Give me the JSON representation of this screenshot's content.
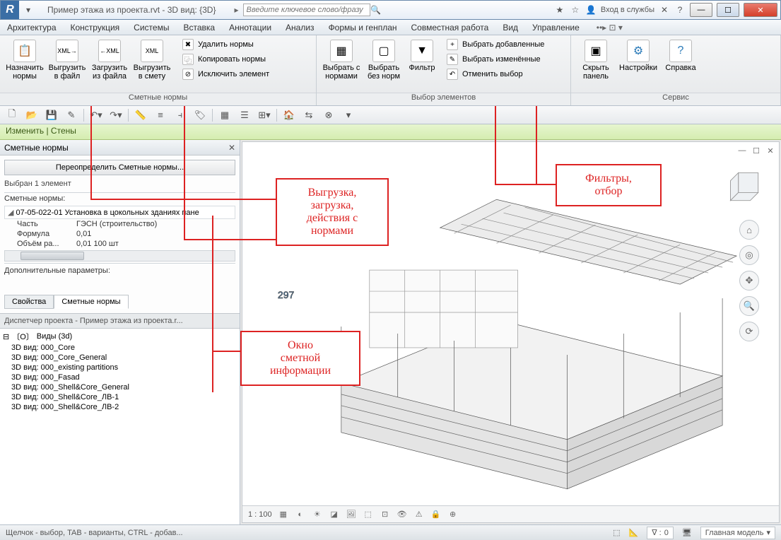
{
  "titlebar": {
    "title": "Пример этажа из проекта.rvt - 3D вид: {3D}",
    "search_placeholder": "Введите ключевое слово/фразу",
    "login_label": "Вход в службы"
  },
  "menu": {
    "items": [
      "Архитектура",
      "Конструкция",
      "Системы",
      "Вставка",
      "Аннотации",
      "Анализ",
      "Формы и генплан",
      "Совместная работа",
      "Вид",
      "Управление"
    ]
  },
  "ribbon": {
    "group1": {
      "title": "Сметные нормы",
      "btn_assign": "Назначить нормы",
      "btn_export": "Выгрузить в файл",
      "btn_import": "Загрузить из файла",
      "btn_export_est": "Выгрузить в смету",
      "btn_delete": "Удалить нормы",
      "btn_copy": "Копировать нормы",
      "btn_exclude": "Исключить элемент"
    },
    "group2": {
      "title": "Выбор элементов",
      "btn_sel_with": "Выбрать с нормами",
      "btn_sel_without": "Выбрать без норм",
      "btn_filter": "Фильтр",
      "btn_sel_added": "Выбрать добавленные",
      "btn_sel_changed": "Выбрать изменённые",
      "btn_cancel_sel": "Отменить выбор"
    },
    "group3": {
      "title": "Сервис",
      "btn_hide": "Скрыть панель",
      "btn_settings": "Настройки",
      "btn_help": "Справка"
    }
  },
  "context_bar": "Изменить | Стены",
  "panel": {
    "title": "Сметные нормы",
    "override_btn": "Переопределить Сметные нормы...",
    "selection_text": "Выбран 1 элемент",
    "norms_label": "Сметные нормы:",
    "norm_code": "07-05-022-01 Установка в цокольных зданиях пане",
    "row_part_l": "Часть",
    "row_part_r": "ГЭСН (строительство)",
    "row_formula_l": "Формула",
    "row_formula_r": "0,01",
    "row_volume_l": "Объём ра...",
    "row_volume_r": "0,01 100 шт",
    "addl_label": "Дополнительные параметры:",
    "tab_props": "Свойства",
    "tab_norms": "Сметные нормы"
  },
  "browser": {
    "title": "Диспетчер проекта - Пример этажа из проекта.r...",
    "root": "Виды (3d)",
    "items": [
      "3D вид: 000_Core",
      "3D вид: 000_Core_General",
      "3D вид: 000_existing partitions",
      "3D вид: 000_Fasad",
      "3D вид: 000_Shell&Core_General",
      "3D вид: 000_Shell&Core_ЛВ-1",
      "3D вид: 000_Shell&Core_ЛВ-2"
    ]
  },
  "viewport": {
    "scale": "1 : 100",
    "axis_num": "297"
  },
  "statusbar": {
    "hint": "Щелчок - выбор, TAB - варианты, CTRL - добав...",
    "num": "0",
    "model_label": "Главная модель"
  },
  "callouts": {
    "c1": "Выгрузка,\nзагрузка,\nдействия с\nнормами",
    "c2": "Фильтры,\nотбор",
    "c3": "Окно\nсметной\nинформации"
  }
}
